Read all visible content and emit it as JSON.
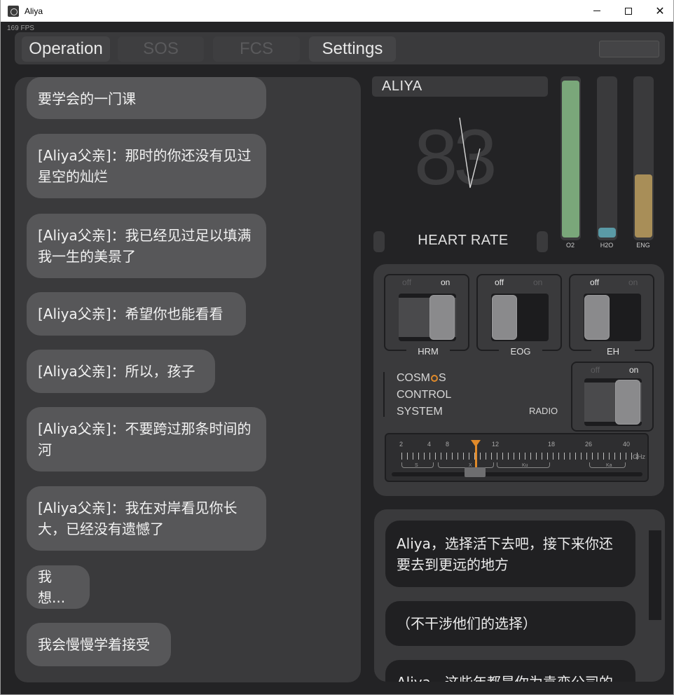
{
  "window": {
    "title": "Aliya",
    "fps": "169 FPS"
  },
  "tabs": [
    {
      "label": "Operation",
      "active": true
    },
    {
      "label": "SOS",
      "active": false
    },
    {
      "label": "FCS",
      "active": false
    },
    {
      "label": "Settings",
      "active": true
    }
  ],
  "chat_history": [
    "要学会的一门课",
    "[Aliya父亲]：那时的你还没有见过星空的灿烂",
    "[Aliya父亲]：我已经见过足以填满我一生的美景了",
    "[Aliya父亲]：希望你也能看看",
    "[Aliya父亲]：所以，孩子",
    "[Aliya父亲]：不要跨过那条时间的河",
    "[Aliya父亲]：我在对岸看见你长大，已经没有遗憾了",
    "我想...",
    "我会慢慢学着接受"
  ],
  "status": {
    "name": "ALIYA",
    "heart_rate_value": "83",
    "heart_rate_label": "HEART RATE"
  },
  "gauges": [
    {
      "label": "O2",
      "level": 0.99,
      "color": "#7aa77a"
    },
    {
      "label": "H2O",
      "level": 0.06,
      "color": "#5a9aa6"
    },
    {
      "label": "ENG",
      "level": 0.4,
      "color": "#a88e58"
    }
  ],
  "switches": [
    {
      "label": "HRM",
      "off": "off",
      "on": "on",
      "state": "on"
    },
    {
      "label": "EOG",
      "off": "off",
      "on": "on",
      "state": "off"
    },
    {
      "label": "EH",
      "off": "off",
      "on": "on",
      "state": "off"
    },
    {
      "label": "RADIO",
      "off": "off",
      "on": "on",
      "state": "on"
    }
  ],
  "cosmos": {
    "line1_a": "COSM",
    "line1_b": "S",
    "line2": "CONTROL",
    "line3": "SYSTEM"
  },
  "tuner": {
    "ticks": [
      "2",
      "4",
      "8",
      "12",
      "18",
      "26",
      "40"
    ],
    "bands": [
      "S",
      "X",
      "Ku",
      "Ka"
    ],
    "unit": "GHz",
    "accent": "#e08a2a"
  },
  "choices": [
    "Aliya，选择活下去吧，接下来你还要去到更远的地方",
    "（不干涉他们的选择）",
    "Aliya，这些年都是你为袁恋公司的"
  ]
}
